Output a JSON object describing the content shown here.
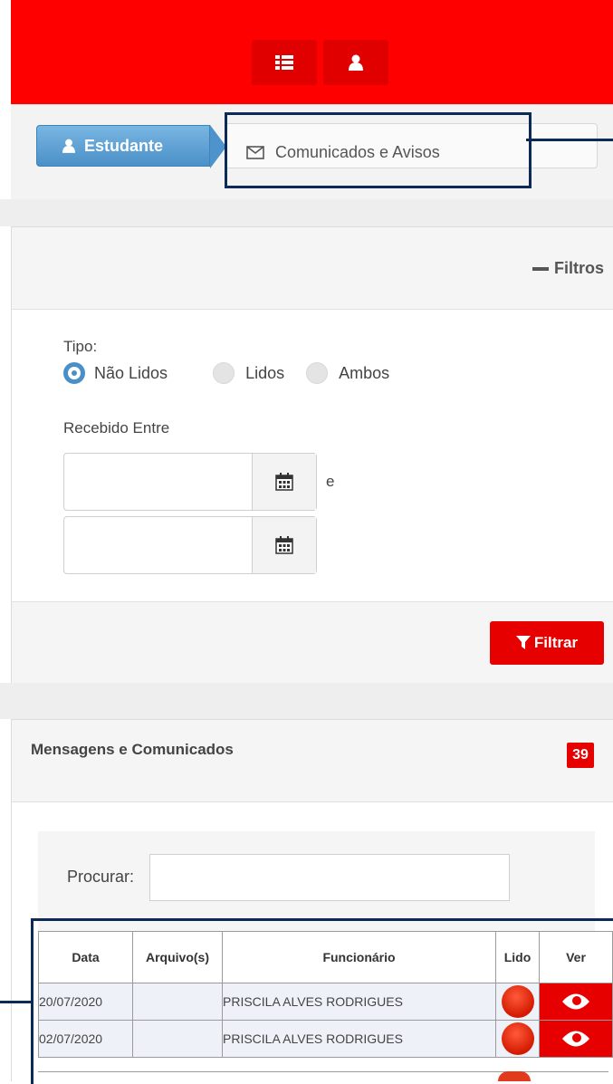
{
  "colors": {
    "topbar": "#ff0000",
    "accent_blue": "#4a90c8",
    "danger": "#e60000",
    "highlight": "#0b2a57"
  },
  "topbar": {
    "icons": [
      "list-icon",
      "user-icon"
    ]
  },
  "breadcrumb": {
    "active": "Estudante",
    "current": "Comunicados e Avisos"
  },
  "filters": {
    "toggle_label": "Filtros",
    "tipo_label": "Tipo:",
    "options": [
      {
        "label": "Não Lidos",
        "selected": true
      },
      {
        "label": "Lidos",
        "selected": false
      },
      {
        "label": "Ambos",
        "selected": false
      }
    ],
    "received_label": "Recebido Entre",
    "between_joiner": "e",
    "filter_button": "Filtrar"
  },
  "messages": {
    "title": "Mensagens e Comunicados",
    "count": "39",
    "search_label": "Procurar:",
    "columns": [
      "Data",
      "Arquivo(s)",
      "Funcionário",
      "Lido",
      "Ver"
    ],
    "rows": [
      {
        "date": "20/07/2020",
        "files": "",
        "employee": "PRISCILA ALVES RODRIGUES",
        "read": false
      },
      {
        "date": "02/07/2020",
        "files": "",
        "employee": "PRISCILA ALVES RODRIGUES",
        "read": false
      }
    ]
  }
}
